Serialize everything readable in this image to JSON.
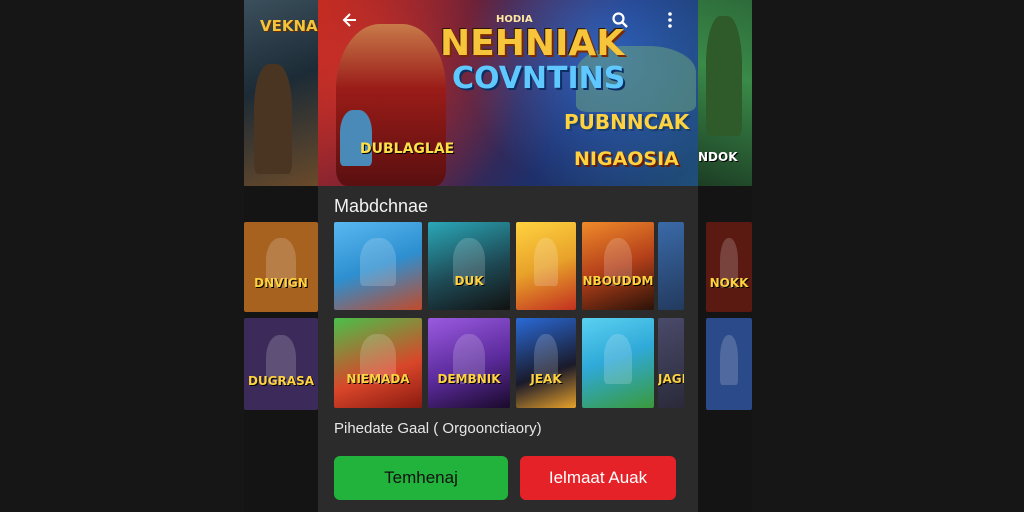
{
  "header": {
    "title": "NEHNIAK",
    "title_top": "HODIA",
    "subtitle": "COVNTINS",
    "tag_right": "PUBNNCAK",
    "tag_bottom": "NIGAOSIA",
    "tag_left": "DUBLAGLAE",
    "side_left_logo": "VEKNAK",
    "side_right_logo": "NDOK"
  },
  "section": {
    "title": "Mabdchnae"
  },
  "grid": {
    "row1": [
      {
        "label": "",
        "bg": "#2e8fd0"
      },
      {
        "label": "DUK",
        "bg": "#1e4a55"
      },
      {
        "label": "",
        "bg": "#e8a22a"
      },
      {
        "label": "NBOUDDM",
        "bg": "#b4401a"
      },
      {
        "label": "",
        "bg": "#233a5e"
      }
    ],
    "row2": [
      {
        "label": "NIEMADA",
        "bg": "#d9462a"
      },
      {
        "label": "DEMBNIK",
        "bg": "#5a2a9a"
      },
      {
        "label": "JEAK",
        "bg": "#1a1a2a"
      },
      {
        "label": "",
        "bg": "#2fa9d8"
      },
      {
        "label": "JAGL",
        "bg": "#2a2a3a"
      }
    ],
    "side_left": [
      {
        "label": "DNVIGN",
        "bg": "#a8621f"
      },
      {
        "label": "DUGRASA",
        "bg": "#3b2a5a"
      }
    ],
    "side_right": [
      {
        "label": "NOKK",
        "bg": "#5a1a12"
      },
      {
        "label": "",
        "bg": "#2a4a8a"
      }
    ]
  },
  "caption": "Pihedate Gaal ( Orgoonctiaory)",
  "buttons": {
    "primary": "Temhenaj",
    "secondary": "Ielmaat Auak"
  }
}
